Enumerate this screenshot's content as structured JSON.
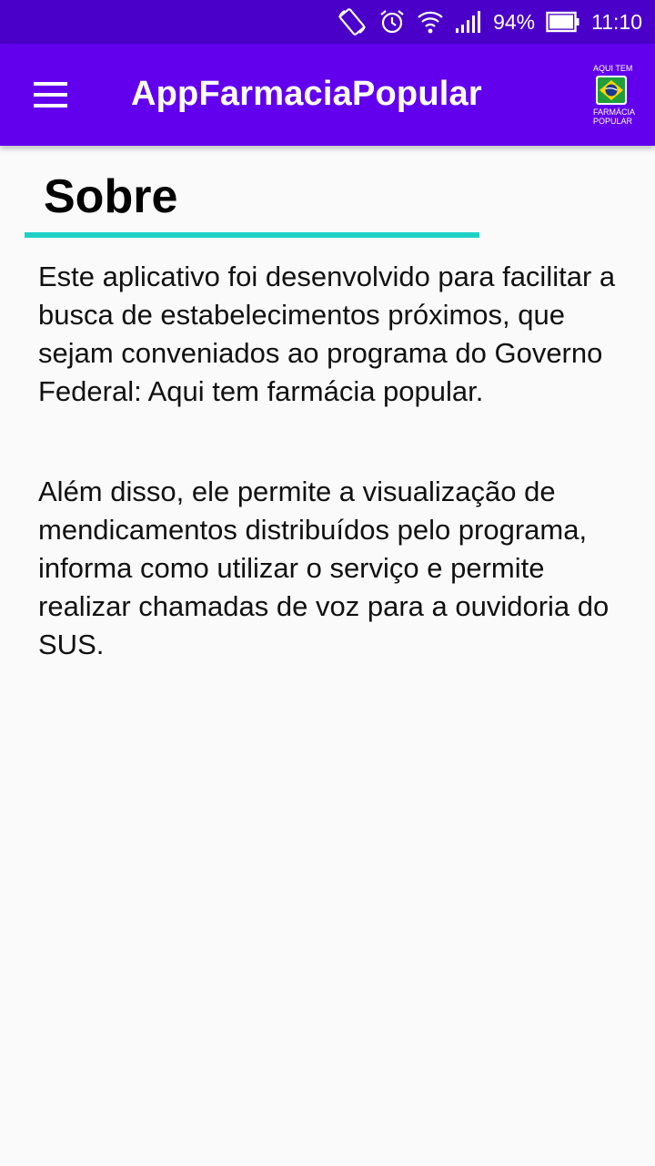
{
  "status_bar": {
    "battery_percent": "94%",
    "time": "11:10",
    "icons": [
      "rotate-icon",
      "alarm-icon",
      "wifi-icon",
      "signal-icon",
      "battery-icon"
    ]
  },
  "app_bar": {
    "title": "AppFarmaciaPopular",
    "menu_icon": "hamburger-menu-icon",
    "logo": {
      "top_text": "AQUI TEM",
      "bottom_line1": "FARMÁCIA",
      "bottom_line2": "POPULAR"
    }
  },
  "main": {
    "section_title": "Sobre",
    "paragraphs": [
      "Este aplicativo foi desenvolvido para facilitar a busca de estabelecimentos próximos, que sejam conveniados ao programa do Governo Federal: Aqui tem farmácia popular.",
      "Além disso, ele permite a visualização de mendicamentos distribuídos pelo programa, informa como utilizar o serviço e permite realizar chamadas de voz para a ouvidoria do SUS."
    ]
  },
  "colors": {
    "status_bar": "#4a00c8",
    "app_bar": "#6200ee",
    "underline_accent": "#1fd1c5",
    "background": "#fafafa"
  }
}
